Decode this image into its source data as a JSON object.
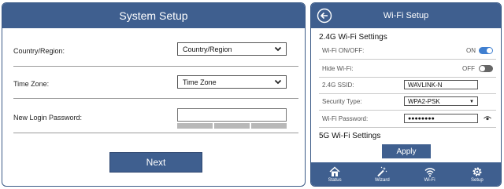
{
  "system_setup": {
    "title": "System Setup",
    "country_label": "Country/Region:",
    "country_value": "Country/Region",
    "timezone_label": "Time Zone:",
    "timezone_value": "Time Zone",
    "password_label": "New Login Password:",
    "next_label": "Next"
  },
  "wifi_setup": {
    "title": "Wi-Fi Setup",
    "section_24g": "2.4G Wi-Fi Settings",
    "wifi_onoff_label": "Wi-Fi ON/OFF:",
    "wifi_onoff_state": "ON",
    "hide_wifi_label": "Hide Wi-Fi:",
    "hide_wifi_state": "OFF",
    "ssid_label": "2.4G SSID:",
    "ssid_value": "WAVLINK-N",
    "security_label": "Security Type:",
    "security_value": "WPA2-PSK",
    "password_label": "Wi-Fi Password:",
    "password_value": "●●●●●●●●",
    "section_5g": "5G Wi-Fi Settings",
    "apply_label": "Apply",
    "nav": {
      "status": "Status",
      "wizard": "Wizard",
      "wifi": "Wi-Fi",
      "setup": "Setup"
    }
  },
  "colors": {
    "brand": "#3f5f8f",
    "toggle_on": "#3f7fd0",
    "toggle_off": "#666666"
  }
}
